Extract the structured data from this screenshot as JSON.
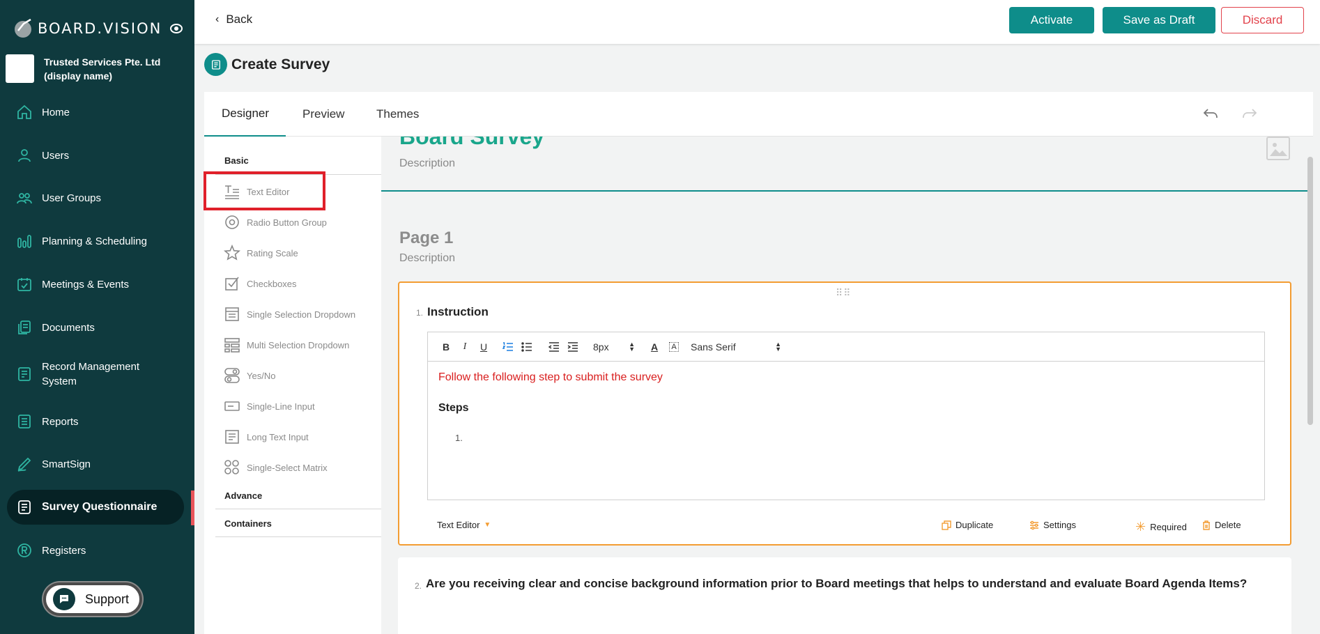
{
  "brand": {
    "name": "BOARD.VISION"
  },
  "org": {
    "name": "Trusted Services Pte. Ltd (display name)"
  },
  "nav": {
    "items": [
      {
        "label": "Home"
      },
      {
        "label": "Users"
      },
      {
        "label": "User Groups"
      },
      {
        "label": "Planning & Scheduling"
      },
      {
        "label": "Meetings & Events"
      },
      {
        "label": "Documents"
      },
      {
        "label": "Record Management System"
      },
      {
        "label": "Reports"
      },
      {
        "label": "SmartSign"
      },
      {
        "label": "Survey Questionnaire"
      },
      {
        "label": "Registers"
      }
    ],
    "active_index": 9
  },
  "support": {
    "label": "Support"
  },
  "topbar": {
    "back": "Back",
    "activate": "Activate",
    "save_draft": "Save as Draft",
    "discard": "Discard"
  },
  "page": {
    "title": "Create Survey"
  },
  "tabs": [
    {
      "label": "Designer"
    },
    {
      "label": "Preview"
    },
    {
      "label": "Themes"
    }
  ],
  "toolbox": {
    "sections": {
      "basic": "Basic",
      "advance": "Advance",
      "containers": "Containers"
    },
    "items": [
      {
        "label": "Text Editor",
        "icon": "text-editor-icon"
      },
      {
        "label": "Radio Button Group",
        "icon": "radio-icon"
      },
      {
        "label": "Rating Scale",
        "icon": "star-icon"
      },
      {
        "label": "Checkboxes",
        "icon": "checkbox-icon"
      },
      {
        "label": "Single Selection Dropdown",
        "icon": "dropdown-icon"
      },
      {
        "label": "Multi Selection Dropdown",
        "icon": "multi-dropdown-icon"
      },
      {
        "label": "Yes/No",
        "icon": "toggle-icon"
      },
      {
        "label": "Single-Line Input",
        "icon": "input-icon"
      },
      {
        "label": "Long Text Input",
        "icon": "textarea-icon"
      },
      {
        "label": "Single-Select Matrix",
        "icon": "matrix-icon"
      }
    ]
  },
  "survey": {
    "title": "Board Survey",
    "description": "Description",
    "page_name": "Page 1",
    "page_description": "Description"
  },
  "question1": {
    "number": "1.",
    "title": "Instruction",
    "editor": {
      "font_size": "8px",
      "font_family": "Sans Serif",
      "red_text": "Follow the following step to submit the survey",
      "steps_heading": "Steps",
      "list_item": "1."
    },
    "footer": {
      "type": "Text Editor",
      "duplicate": "Duplicate",
      "settings": "Settings",
      "required": "Required",
      "delete": "Delete"
    }
  },
  "question2": {
    "number": "2.",
    "title": "Are you receiving clear and concise background information prior to Board meetings that helps to understand and evaluate Board Agenda Items?"
  },
  "colors": {
    "sidebar": "#0f3a3e",
    "accent": "#0e8d8a",
    "survey_title": "#19a68b",
    "discard": "#e2424b",
    "highlight": "#e0202a",
    "question_border": "#f39c32"
  }
}
